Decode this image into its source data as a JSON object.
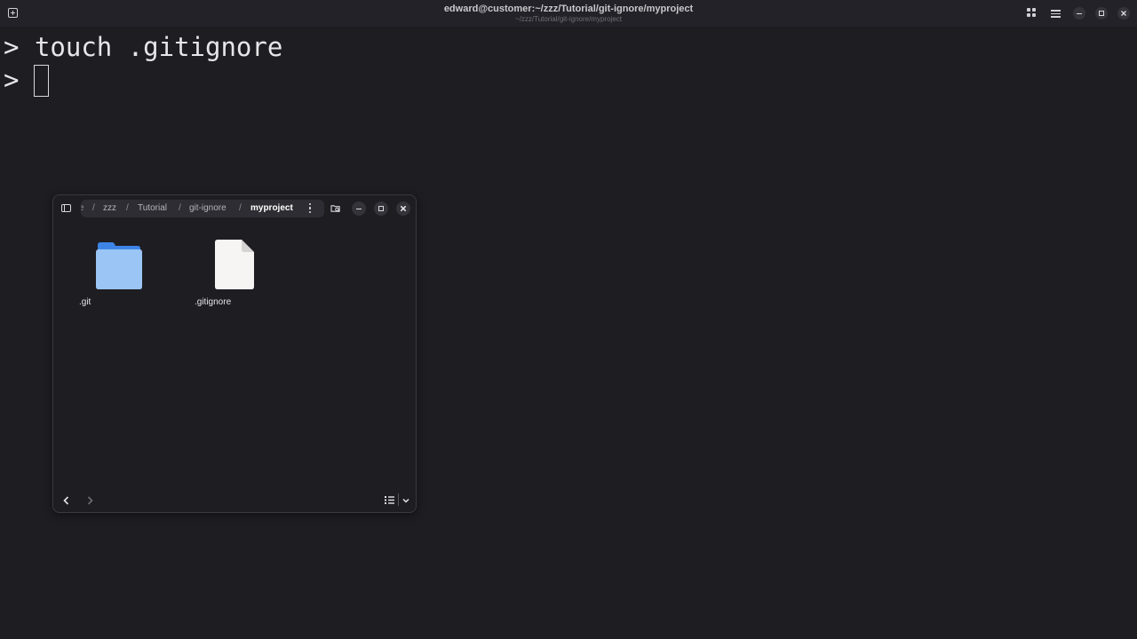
{
  "terminal": {
    "title": "edward@customer:~/zzz/Tutorial/git-ignore/myproject",
    "subtitle": "~/zzz/Tutorial/git-ignore/myproject",
    "prompt": ">",
    "lines": [
      {
        "prompt": ">",
        "command": "touch .gitignore"
      },
      {
        "prompt": ">",
        "command": ""
      }
    ],
    "header_icons": [
      "new-tab-icon",
      "grid-view-icon",
      "menu-icon",
      "minimize-icon",
      "maximize-icon",
      "close-icon"
    ]
  },
  "file_manager": {
    "breadcrumb": {
      "truncated": "e",
      "separator": "/",
      "items": [
        "zzz",
        "Tutorial",
        "git-ignore",
        "myproject"
      ]
    },
    "files": [
      {
        "name": ".git",
        "type": "folder",
        "icon": "folder-icon"
      },
      {
        "name": ".gitignore",
        "type": "file",
        "icon": "document-icon"
      }
    ],
    "colors": {
      "folder_front": "#9ac5f4",
      "folder_back": "#3d84e6",
      "document": "#f6f5f4"
    }
  }
}
